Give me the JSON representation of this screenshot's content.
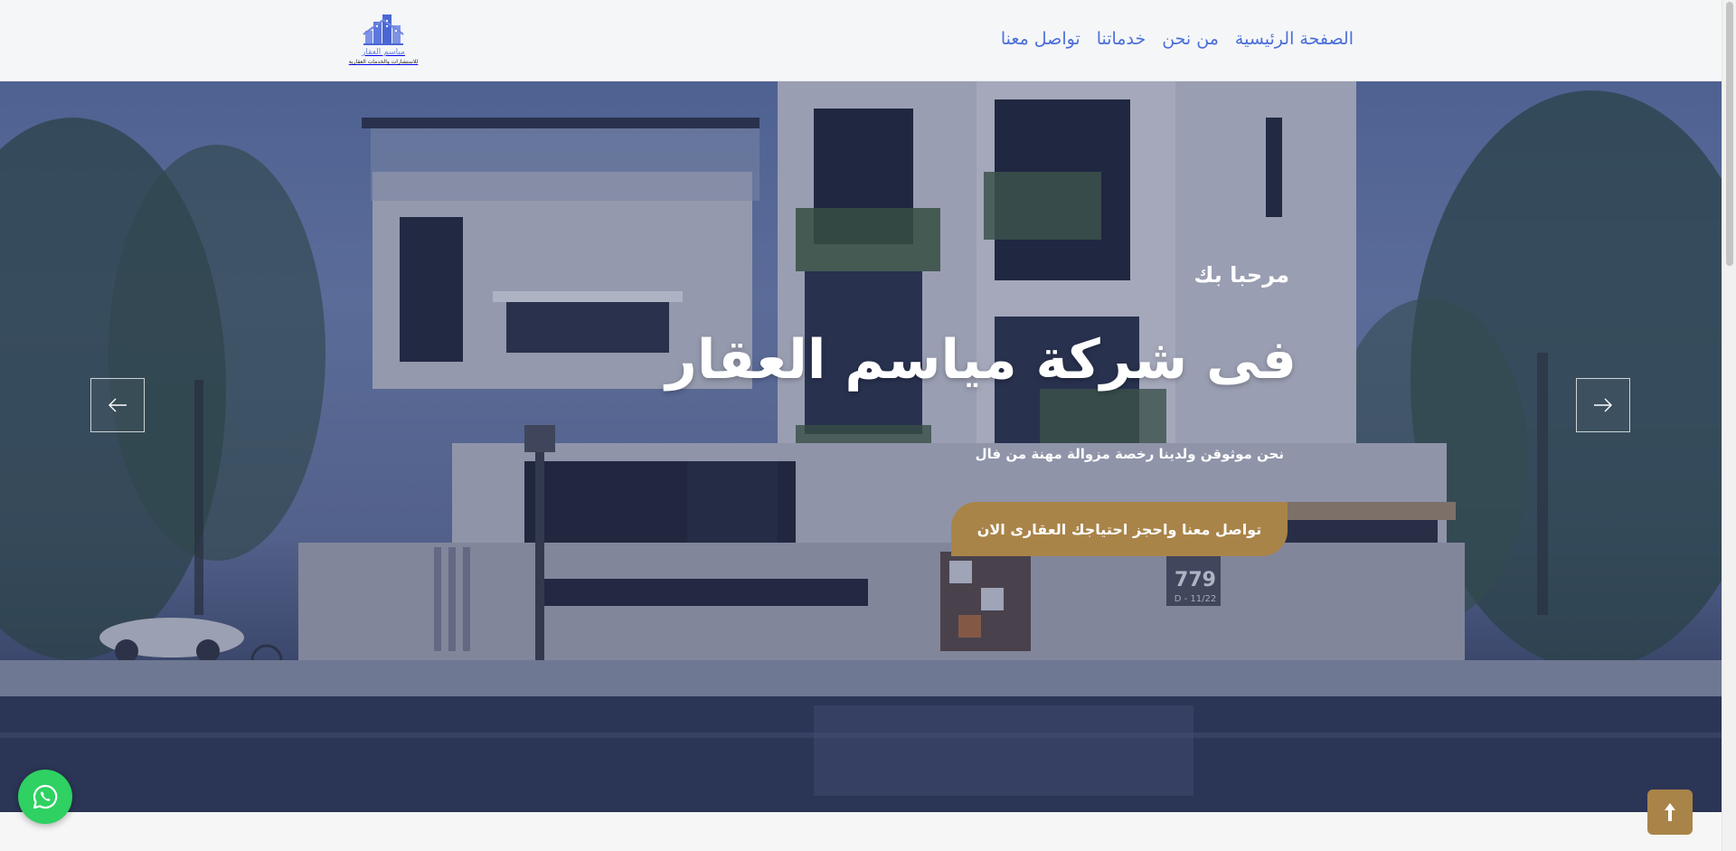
{
  "header": {
    "logo": {
      "title": "مياسم العقار",
      "subtitle": "للاستشارات والخدمات العقارية"
    },
    "nav": [
      {
        "label": "الصفحة الرئيسية"
      },
      {
        "label": "من نحن"
      },
      {
        "label": "خدماتنا"
      },
      {
        "label": "تواصل معنا"
      }
    ]
  },
  "hero": {
    "welcome": "مرحبا بك",
    "title": "فى شركة مياسم العقار",
    "description": "نحن موثوقن ولدينا رخصة مزوالة مهنة من فال",
    "cta_label": "تواصل معنا واحجز احتياجك العقارى الان",
    "house_number": "779",
    "house_plate": "11/22 - D",
    "prev_icon": "arrow-left-icon",
    "next_icon": "arrow-right-icon"
  },
  "floating": {
    "whatsapp_icon": "whatsapp-icon",
    "scroll_top_icon": "arrow-up-icon"
  },
  "colors": {
    "nav_link": "#4a6fd8",
    "accent_gold": "#a98449",
    "whatsapp_green": "#2ed162",
    "header_bg": "#f5f6f8"
  }
}
